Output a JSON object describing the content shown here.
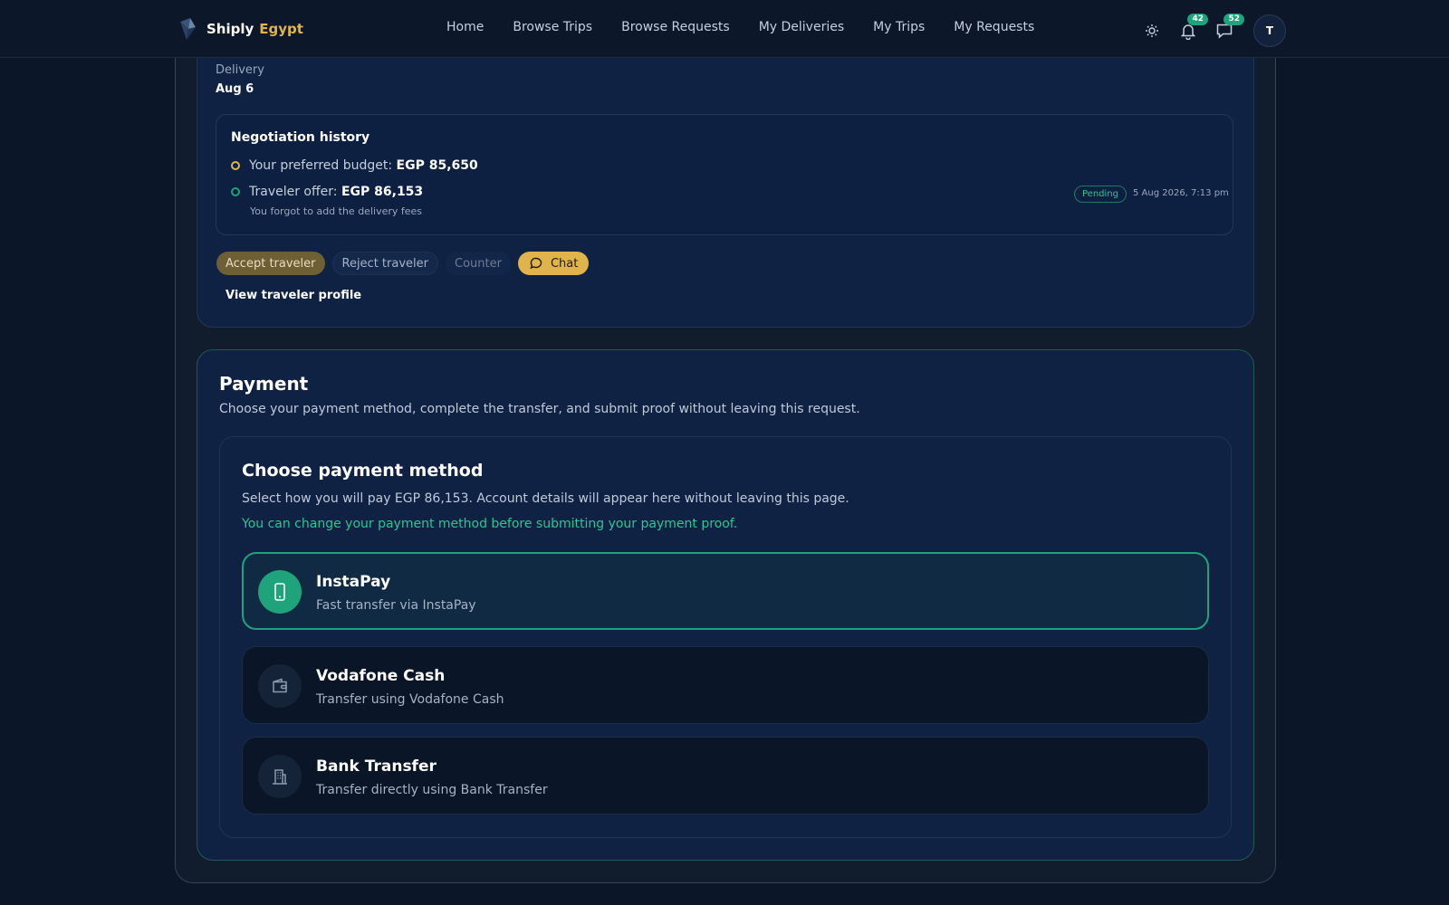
{
  "brand": {
    "name": "Shiply",
    "country": "Egypt"
  },
  "nav": {
    "links": [
      "Home",
      "Browse Trips",
      "Browse Requests",
      "My Deliveries",
      "My Trips",
      "My Requests"
    ],
    "notifications_count": "42",
    "messages_count": "52",
    "avatar_initial": "T"
  },
  "delivery": {
    "label": "Delivery",
    "value": "Aug 6"
  },
  "negotiation": {
    "title": "Negotiation history",
    "budget_label": "Your preferred budget:",
    "budget_value": "EGP 85,650",
    "offer_label": "Traveler offer:",
    "offer_value": "EGP 86,153",
    "offer_note": "You forgot to add the delivery fees",
    "status": "Pending",
    "timestamp": "5 Aug 2026, 7:13 pm"
  },
  "actions": {
    "accept": "Accept traveler",
    "reject": "Reject traveler",
    "counter": "Counter",
    "chat": "Chat",
    "view_profile": "View traveler profile"
  },
  "payment": {
    "title": "Payment",
    "subtitle": "Choose your payment method, complete the transfer, and submit proof without leaving this request.",
    "method_title": "Choose payment method",
    "method_subtitle": "Select how you will pay EGP 86,153. Account details will appear here without leaving this page.",
    "method_hint": "You can change your payment method before submitting your payment proof.",
    "options": [
      {
        "name": "InstaPay",
        "desc": "Fast transfer via InstaPay",
        "icon": "phone-icon",
        "selected": true
      },
      {
        "name": "Vodafone Cash",
        "desc": "Transfer using Vodafone Cash",
        "icon": "wallet-icon",
        "selected": false
      },
      {
        "name": "Bank Transfer",
        "desc": "Transfer directly using Bank Transfer",
        "icon": "building-icon",
        "selected": false
      }
    ]
  },
  "colors": {
    "accent": "#1fa37a",
    "brand_gold": "#e0b44a",
    "background": "#0b1628"
  }
}
